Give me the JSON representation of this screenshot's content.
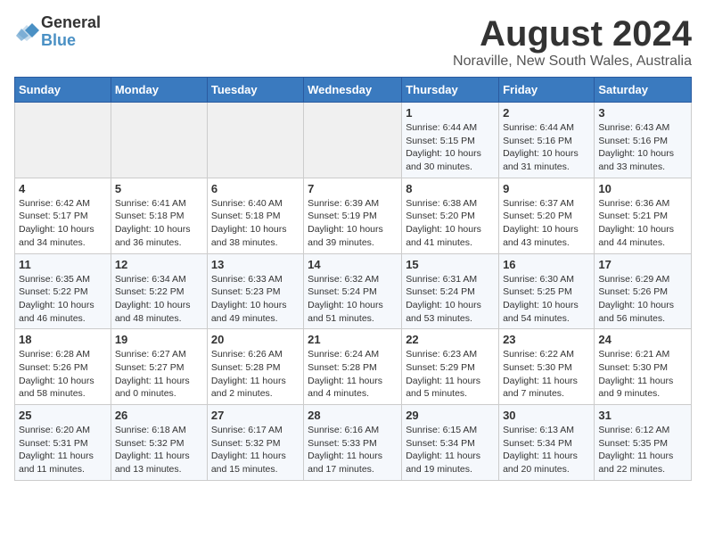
{
  "logo": {
    "line1": "General",
    "line2": "Blue"
  },
  "title": "August 2024",
  "location": "Noraville, New South Wales, Australia",
  "weekdays": [
    "Sunday",
    "Monday",
    "Tuesday",
    "Wednesday",
    "Thursday",
    "Friday",
    "Saturday"
  ],
  "weeks": [
    [
      {
        "day": "",
        "info": ""
      },
      {
        "day": "",
        "info": ""
      },
      {
        "day": "",
        "info": ""
      },
      {
        "day": "",
        "info": ""
      },
      {
        "day": "1",
        "info": "Sunrise: 6:44 AM\nSunset: 5:15 PM\nDaylight: 10 hours\nand 30 minutes."
      },
      {
        "day": "2",
        "info": "Sunrise: 6:44 AM\nSunset: 5:16 PM\nDaylight: 10 hours\nand 31 minutes."
      },
      {
        "day": "3",
        "info": "Sunrise: 6:43 AM\nSunset: 5:16 PM\nDaylight: 10 hours\nand 33 minutes."
      }
    ],
    [
      {
        "day": "4",
        "info": "Sunrise: 6:42 AM\nSunset: 5:17 PM\nDaylight: 10 hours\nand 34 minutes."
      },
      {
        "day": "5",
        "info": "Sunrise: 6:41 AM\nSunset: 5:18 PM\nDaylight: 10 hours\nand 36 minutes."
      },
      {
        "day": "6",
        "info": "Sunrise: 6:40 AM\nSunset: 5:18 PM\nDaylight: 10 hours\nand 38 minutes."
      },
      {
        "day": "7",
        "info": "Sunrise: 6:39 AM\nSunset: 5:19 PM\nDaylight: 10 hours\nand 39 minutes."
      },
      {
        "day": "8",
        "info": "Sunrise: 6:38 AM\nSunset: 5:20 PM\nDaylight: 10 hours\nand 41 minutes."
      },
      {
        "day": "9",
        "info": "Sunrise: 6:37 AM\nSunset: 5:20 PM\nDaylight: 10 hours\nand 43 minutes."
      },
      {
        "day": "10",
        "info": "Sunrise: 6:36 AM\nSunset: 5:21 PM\nDaylight: 10 hours\nand 44 minutes."
      }
    ],
    [
      {
        "day": "11",
        "info": "Sunrise: 6:35 AM\nSunset: 5:22 PM\nDaylight: 10 hours\nand 46 minutes."
      },
      {
        "day": "12",
        "info": "Sunrise: 6:34 AM\nSunset: 5:22 PM\nDaylight: 10 hours\nand 48 minutes."
      },
      {
        "day": "13",
        "info": "Sunrise: 6:33 AM\nSunset: 5:23 PM\nDaylight: 10 hours\nand 49 minutes."
      },
      {
        "day": "14",
        "info": "Sunrise: 6:32 AM\nSunset: 5:24 PM\nDaylight: 10 hours\nand 51 minutes."
      },
      {
        "day": "15",
        "info": "Sunrise: 6:31 AM\nSunset: 5:24 PM\nDaylight: 10 hours\nand 53 minutes."
      },
      {
        "day": "16",
        "info": "Sunrise: 6:30 AM\nSunset: 5:25 PM\nDaylight: 10 hours\nand 54 minutes."
      },
      {
        "day": "17",
        "info": "Sunrise: 6:29 AM\nSunset: 5:26 PM\nDaylight: 10 hours\nand 56 minutes."
      }
    ],
    [
      {
        "day": "18",
        "info": "Sunrise: 6:28 AM\nSunset: 5:26 PM\nDaylight: 10 hours\nand 58 minutes."
      },
      {
        "day": "19",
        "info": "Sunrise: 6:27 AM\nSunset: 5:27 PM\nDaylight: 11 hours\nand 0 minutes."
      },
      {
        "day": "20",
        "info": "Sunrise: 6:26 AM\nSunset: 5:28 PM\nDaylight: 11 hours\nand 2 minutes."
      },
      {
        "day": "21",
        "info": "Sunrise: 6:24 AM\nSunset: 5:28 PM\nDaylight: 11 hours\nand 4 minutes."
      },
      {
        "day": "22",
        "info": "Sunrise: 6:23 AM\nSunset: 5:29 PM\nDaylight: 11 hours\nand 5 minutes."
      },
      {
        "day": "23",
        "info": "Sunrise: 6:22 AM\nSunset: 5:30 PM\nDaylight: 11 hours\nand 7 minutes."
      },
      {
        "day": "24",
        "info": "Sunrise: 6:21 AM\nSunset: 5:30 PM\nDaylight: 11 hours\nand 9 minutes."
      }
    ],
    [
      {
        "day": "25",
        "info": "Sunrise: 6:20 AM\nSunset: 5:31 PM\nDaylight: 11 hours\nand 11 minutes."
      },
      {
        "day": "26",
        "info": "Sunrise: 6:18 AM\nSunset: 5:32 PM\nDaylight: 11 hours\nand 13 minutes."
      },
      {
        "day": "27",
        "info": "Sunrise: 6:17 AM\nSunset: 5:32 PM\nDaylight: 11 hours\nand 15 minutes."
      },
      {
        "day": "28",
        "info": "Sunrise: 6:16 AM\nSunset: 5:33 PM\nDaylight: 11 hours\nand 17 minutes."
      },
      {
        "day": "29",
        "info": "Sunrise: 6:15 AM\nSunset: 5:34 PM\nDaylight: 11 hours\nand 19 minutes."
      },
      {
        "day": "30",
        "info": "Sunrise: 6:13 AM\nSunset: 5:34 PM\nDaylight: 11 hours\nand 20 minutes."
      },
      {
        "day": "31",
        "info": "Sunrise: 6:12 AM\nSunset: 5:35 PM\nDaylight: 11 hours\nand 22 minutes."
      }
    ]
  ]
}
